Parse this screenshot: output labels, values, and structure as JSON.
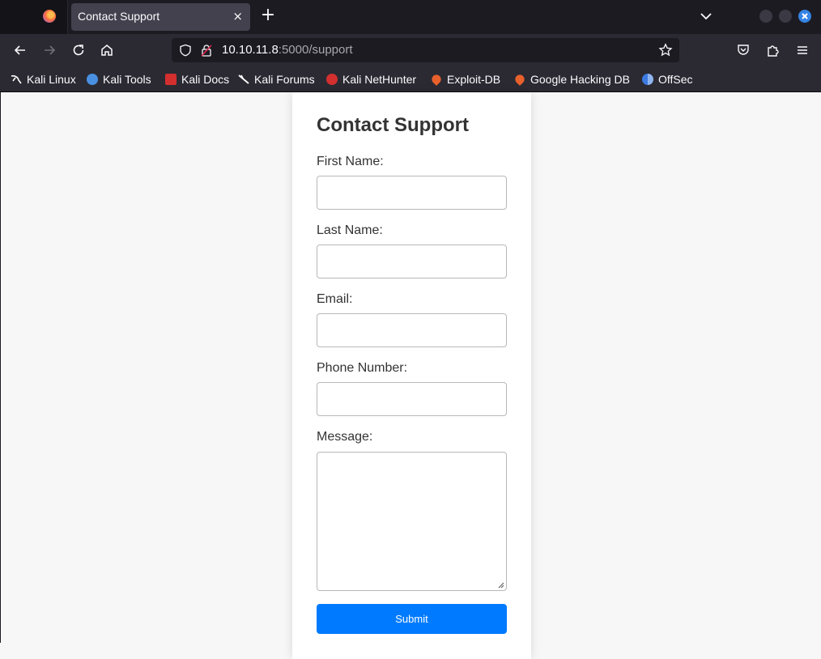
{
  "browser": {
    "tab_title": "Contact Support",
    "tab_close": "×",
    "new_tab": "+",
    "url_host": "10.10.11.8",
    "url_rest": ":5000/support"
  },
  "bookmarks": [
    {
      "label": "Kali Linux",
      "icon": "kali-dragon-icon",
      "color": "#ffffff"
    },
    {
      "label": "Kali Tools",
      "icon": "kali-tools-icon",
      "color": "#4a90e2"
    },
    {
      "label": "Kali Docs",
      "icon": "kali-docs-icon",
      "color": "#d32f2f"
    },
    {
      "label": "Kali Forums",
      "icon": "kali-forums-icon",
      "color": "#ffffff"
    },
    {
      "label": "Kali NetHunter",
      "icon": "kali-nethunter-icon",
      "color": "#d32f2f"
    },
    {
      "label": "Exploit-DB",
      "icon": "exploit-db-icon",
      "color": "#e8612c"
    },
    {
      "label": "Google Hacking DB",
      "icon": "ghdb-icon",
      "color": "#e8612c"
    },
    {
      "label": "OffSec",
      "icon": "offsec-icon",
      "color": "#3d7be0"
    }
  ],
  "form": {
    "title": "Contact Support",
    "first_name_label": "First Name:",
    "first_name_value": "",
    "last_name_label": "Last Name:",
    "last_name_value": "",
    "email_label": "Email:",
    "email_value": "",
    "phone_label": "Phone Number:",
    "phone_value": "",
    "message_label": "Message:",
    "message_value": "",
    "submit_label": "Submit",
    "accent_color": "#007bff"
  }
}
